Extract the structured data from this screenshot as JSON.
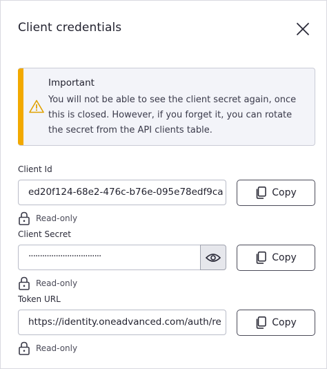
{
  "dialog": {
    "title": "Client credentials",
    "close_icon": "close-icon"
  },
  "alert": {
    "title": "Important",
    "body": "You will not be able to see the client secret again, once this is closed. However, if you forget it, you can rotate the secret from the API clients table.",
    "icon": "warning-icon",
    "accent_color": "#f2a900"
  },
  "fields": {
    "client_id": {
      "label": "Client Id",
      "value": "ed20f124-68e2-476c-b76e-095e78edf9ca",
      "copy_label": "Copy",
      "readonly_label": "Read-only"
    },
    "client_secret": {
      "label": "Client Secret",
      "value": "································",
      "copy_label": "Copy",
      "readonly_label": "Read-only",
      "reveal_icon": "eye-icon"
    },
    "token_url": {
      "label": "Token URL",
      "value": "https://identity.oneadvanced.com/auth/re",
      "copy_label": "Copy",
      "readonly_label": "Read-only"
    }
  }
}
